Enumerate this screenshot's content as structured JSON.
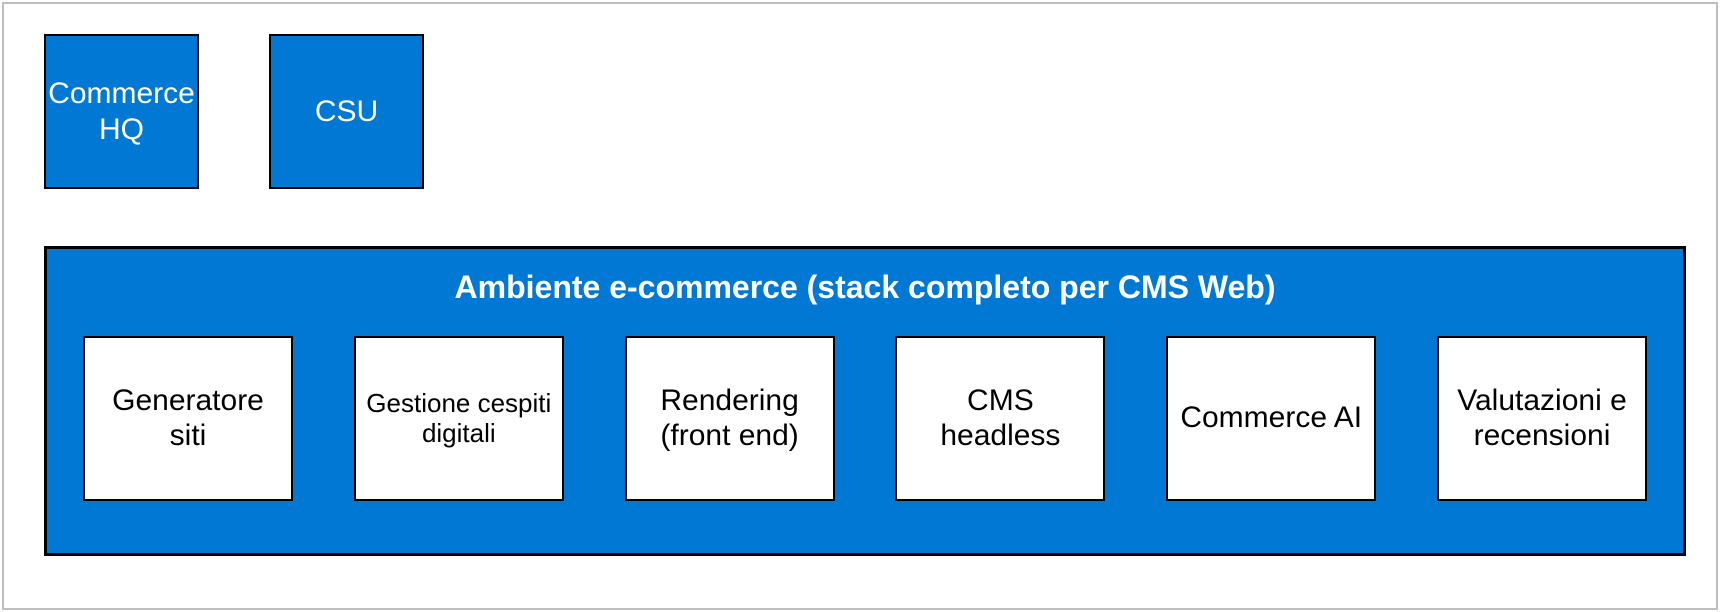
{
  "top_boxes": {
    "commerce_hq": "Commerce HQ",
    "csu": "CSU"
  },
  "environment": {
    "title": "Ambiente e-commerce (stack completo per CMS Web)",
    "modules": {
      "site_builder": "Generatore siti",
      "dam": "Gestione cespiti digitali",
      "rendering": "Rendering (front end)",
      "cms": "CMS headless",
      "ai": "Commerce AI",
      "ratings": "Valutazioni e recensioni"
    }
  }
}
